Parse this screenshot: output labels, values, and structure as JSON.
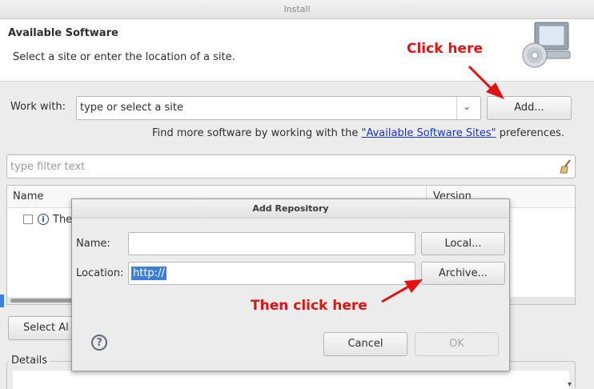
{
  "window": {
    "title": "Install"
  },
  "header": {
    "title": "Available Software",
    "subtitle": "Select a site or enter the location of a site."
  },
  "work_with": {
    "label": "Work with:",
    "placeholder": "type or select a site",
    "add_button": "Add...",
    "more_prefix": "Find more software by working with the ",
    "more_link": "\"Available Software Sites\"",
    "more_suffix": " preferences."
  },
  "filter": {
    "placeholder": "type filter text"
  },
  "table": {
    "col_name": "Name",
    "col_version": "Version",
    "row_text": "The"
  },
  "bottom": {
    "select_all": "Select Al",
    "details": "Details"
  },
  "dialog": {
    "title": "Add Repository",
    "name_label": "Name:",
    "name_value": "",
    "local_button": "Local...",
    "location_label": "Location:",
    "location_value": "http://",
    "archive_button": "Archive...",
    "cancel_button": "Cancel",
    "ok_button": "OK"
  },
  "annotations": {
    "click_here": "Click here",
    "then_click": "Then click here"
  },
  "colors": {
    "annotation": "#e01212",
    "link": "#1a34c8",
    "selection": "#3d7fd6"
  }
}
